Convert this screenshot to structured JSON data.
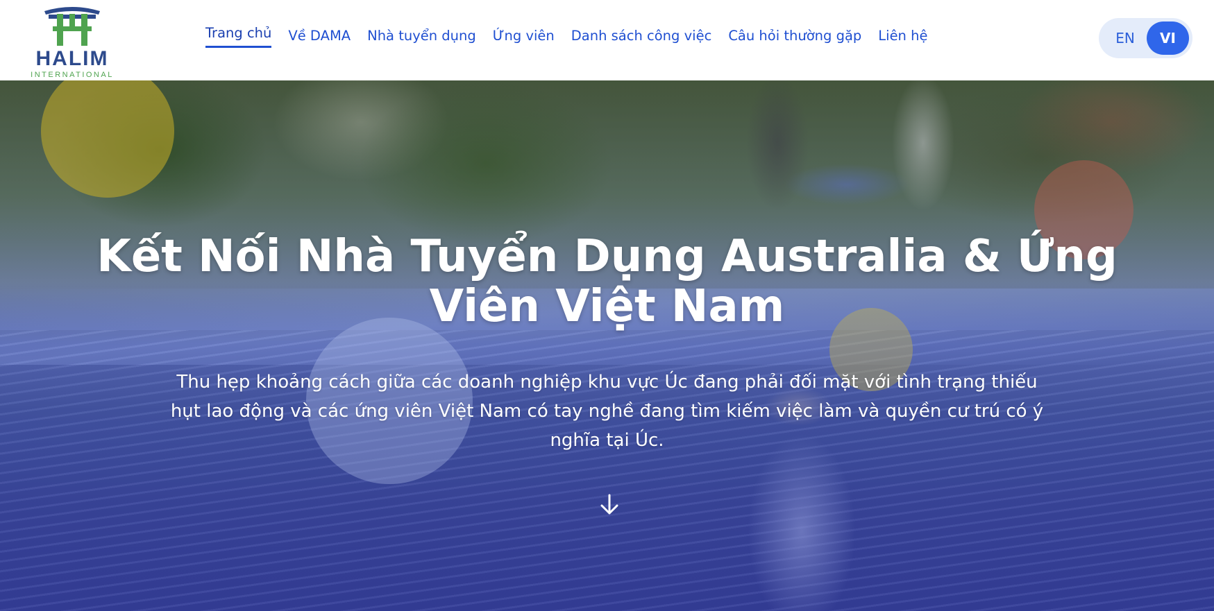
{
  "brand": {
    "name": "HALIM",
    "subtitle": "INTERNATIONAL",
    "colors": {
      "primary": "#2d4a8c",
      "green": "#4fa34f",
      "accent": "#2f66ea"
    },
    "logo_icon": "torii-gate-icon"
  },
  "nav": {
    "items": [
      {
        "label": "Trang chủ",
        "active": true
      },
      {
        "label": "Về DAMA"
      },
      {
        "label": "Nhà tuyển dụng"
      },
      {
        "label": "Ứng viên"
      },
      {
        "label": "Danh sách công việc"
      },
      {
        "label": "Câu hỏi thường gặp"
      },
      {
        "label": "Liên hệ"
      }
    ]
  },
  "language": {
    "options": [
      "EN",
      "VI"
    ],
    "selected": "VI"
  },
  "hero": {
    "title": "Kết Nối Nhà Tuyển Dụng Australia & Ứng Viên Việt Nam",
    "subtitle": "Thu hẹp khoảng cách giữa các doanh nghiệp khu vực Úc đang phải đối mặt với tình trạng thiếu hụt lao động và các ứng viên Việt Nam có tay nghề đang tìm kiếm việc làm và quyền cư trú có ý nghĩa tại Úc.",
    "scroll_icon": "arrow-down-icon"
  }
}
